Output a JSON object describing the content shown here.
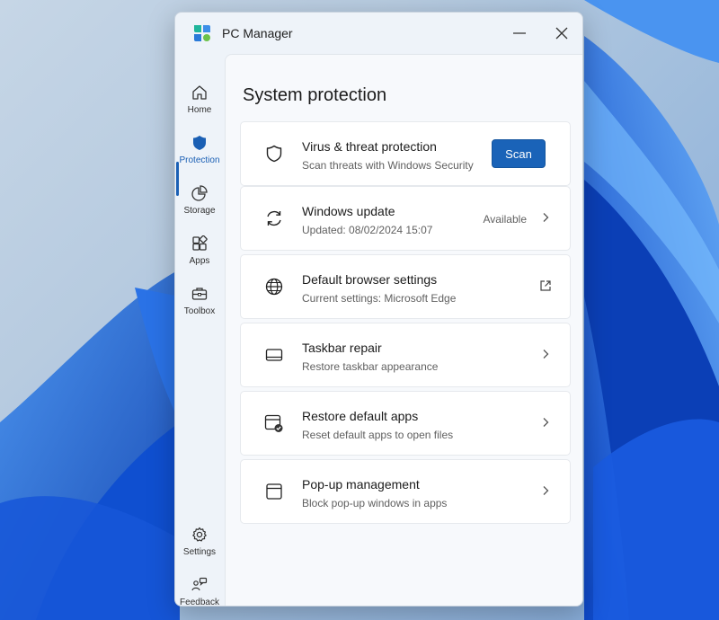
{
  "window": {
    "title": "PC Manager"
  },
  "sidebar": {
    "items": [
      {
        "label": "Home",
        "icon": "home-icon"
      },
      {
        "label": "Protection",
        "icon": "shield-icon",
        "active": true
      },
      {
        "label": "Storage",
        "icon": "pie-chart-icon"
      },
      {
        "label": "Apps",
        "icon": "apps-icon"
      },
      {
        "label": "Toolbox",
        "icon": "toolbox-icon"
      }
    ],
    "bottom_items": [
      {
        "label": "Settings",
        "icon": "gear-icon"
      },
      {
        "label": "Feedback",
        "icon": "feedback-icon"
      }
    ]
  },
  "main": {
    "title": "System protection",
    "cards": [
      {
        "title": "Virus & threat protection",
        "subtitle": "Scan threats with Windows Security",
        "action": "Scan",
        "icon": "shield-outline-icon"
      },
      {
        "title": "Windows update",
        "subtitle": "Updated: 08/02/2024 15:07",
        "status": "Available",
        "icon": "sync-icon"
      },
      {
        "title": "Default browser settings",
        "subtitle": "Current settings: Microsoft Edge",
        "icon": "globe-icon"
      },
      {
        "title": "Taskbar repair",
        "subtitle": "Restore taskbar appearance",
        "icon": "taskbar-icon"
      },
      {
        "title": "Restore default apps",
        "subtitle": "Reset default apps to open files",
        "icon": "default-apps-icon"
      },
      {
        "title": "Pop-up management",
        "subtitle": "Block pop-up windows in apps",
        "icon": "window-icon"
      }
    ]
  },
  "colors": {
    "accent": "#1a63b8",
    "window_bg": "#eef3f9",
    "card_bg": "#ffffff"
  }
}
